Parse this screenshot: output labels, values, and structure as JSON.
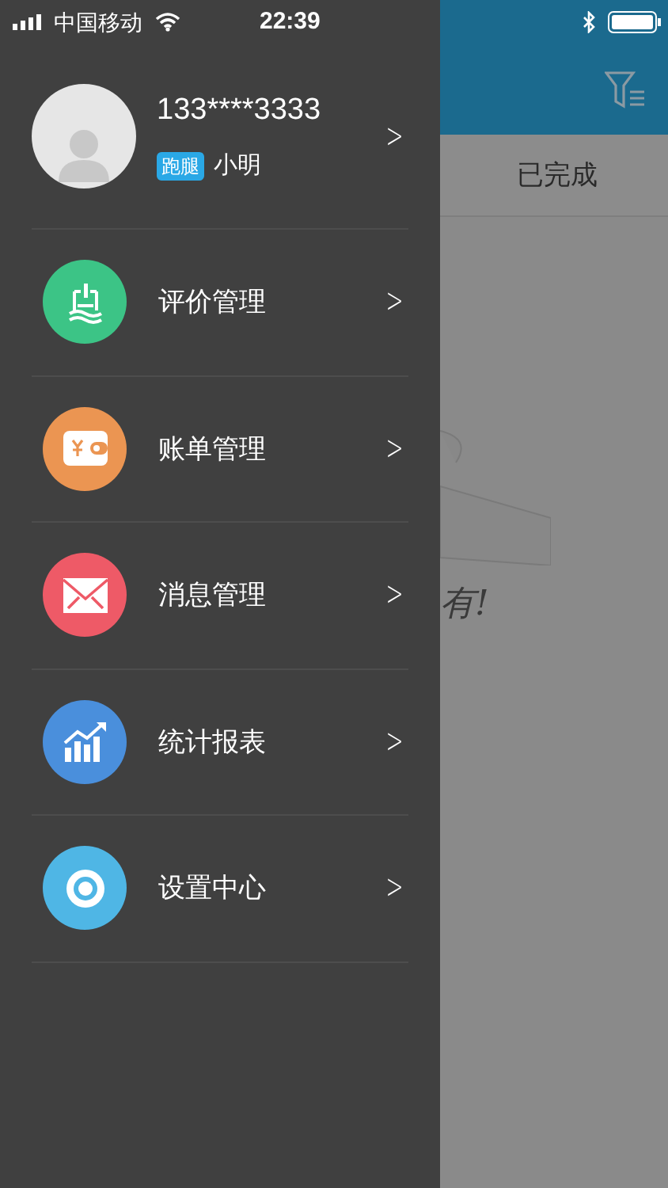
{
  "status_bar": {
    "carrier": "中国移动",
    "time": "22:39"
  },
  "profile": {
    "phone": "133****3333",
    "badge": "跑腿",
    "name": "小明",
    "chevron": ">"
  },
  "menu": [
    {
      "label": "评价管理",
      "color": "#3cc486",
      "chevron": ">"
    },
    {
      "label": "账单管理",
      "color": "#eb9552",
      "chevron": ">"
    },
    {
      "label": "消息管理",
      "color": "#ee5a67",
      "chevron": ">"
    },
    {
      "label": "统计报表",
      "color": "#4a8fdc",
      "chevron": ">"
    },
    {
      "label": "设置中心",
      "color": "#4fb6e5",
      "chevron": ">"
    }
  ],
  "background": {
    "tab": "已完成",
    "empty_message": "有!"
  }
}
